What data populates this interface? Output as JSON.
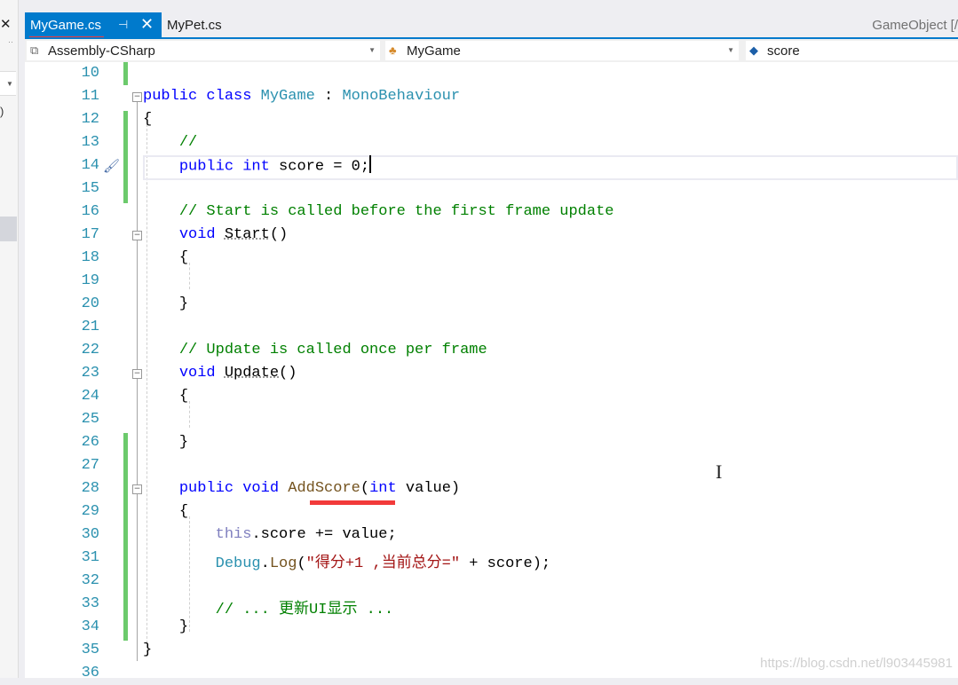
{
  "left_panel": {
    "close_glyph": "✕",
    "dots": "··",
    "dropdown_arrow": "▼",
    "paren": ")"
  },
  "tabs": {
    "active": {
      "label": "MyGame.cs",
      "pin_glyph": "⊣",
      "close_glyph": "✕"
    },
    "inactive": [
      {
        "label": "MyPet.cs"
      }
    ],
    "right_label": "GameObject [/"
  },
  "navbar": {
    "project": {
      "label": "Assembly-CSharp",
      "icon": "project-icon"
    },
    "type": {
      "label": "MyGame",
      "icon": "class-icon"
    },
    "member": {
      "label": "score",
      "icon": "field-icon"
    },
    "dropdown_arrow": "▼"
  },
  "editor": {
    "lines": [
      {
        "n": "10"
      },
      {
        "n": "11"
      },
      {
        "n": "12"
      },
      {
        "n": "13"
      },
      {
        "n": "14"
      },
      {
        "n": "15"
      },
      {
        "n": "16"
      },
      {
        "n": "17"
      },
      {
        "n": "18"
      },
      {
        "n": "19"
      },
      {
        "n": "20"
      },
      {
        "n": "21"
      },
      {
        "n": "22"
      },
      {
        "n": "23"
      },
      {
        "n": "24"
      },
      {
        "n": "25"
      },
      {
        "n": "26"
      },
      {
        "n": "27"
      },
      {
        "n": "28"
      },
      {
        "n": "29"
      },
      {
        "n": "30"
      },
      {
        "n": "31"
      },
      {
        "n": "32"
      },
      {
        "n": "33"
      },
      {
        "n": "34"
      },
      {
        "n": "35"
      },
      {
        "n": "36"
      }
    ],
    "code": {
      "l11": {
        "kw1": "public",
        "kw2": "class",
        "cls": "MyGame",
        "sep": " : ",
        "base": "MonoBehaviour"
      },
      "l12": "{",
      "l13": "//",
      "l14": {
        "kw1": "public",
        "kw2": "int",
        "rest": " score = 0;"
      },
      "l16": "// Start is called before the first frame update",
      "l17": {
        "kw": "void",
        "name": "Start",
        "rest": "()"
      },
      "l18": "{",
      "l20": "}",
      "l22": "// Update is called once per frame",
      "l23": {
        "kw": "void",
        "name": "Update",
        "rest": "()"
      },
      "l24": "{",
      "l26": "}",
      "l28": {
        "kw1": "public",
        "kw2": "void",
        "name": "AddScore",
        "p1": "(",
        "kw3": "int",
        "p2": " value)"
      },
      "l29": "{",
      "l30": {
        "kw": "this",
        "rest": ".score += value;"
      },
      "l31": {
        "cls": "Debug",
        "dot": ".",
        "method": "Log",
        "p1": "(",
        "str": "\"得分+1 ,当前总分=\"",
        "rest": " + score);"
      },
      "l33": "// ... 更新UI显示 ...",
      "l34": "}",
      "l35": "}"
    },
    "fold_glyph": "−"
  },
  "watermark": "https://blog.csdn.net/l903445981"
}
